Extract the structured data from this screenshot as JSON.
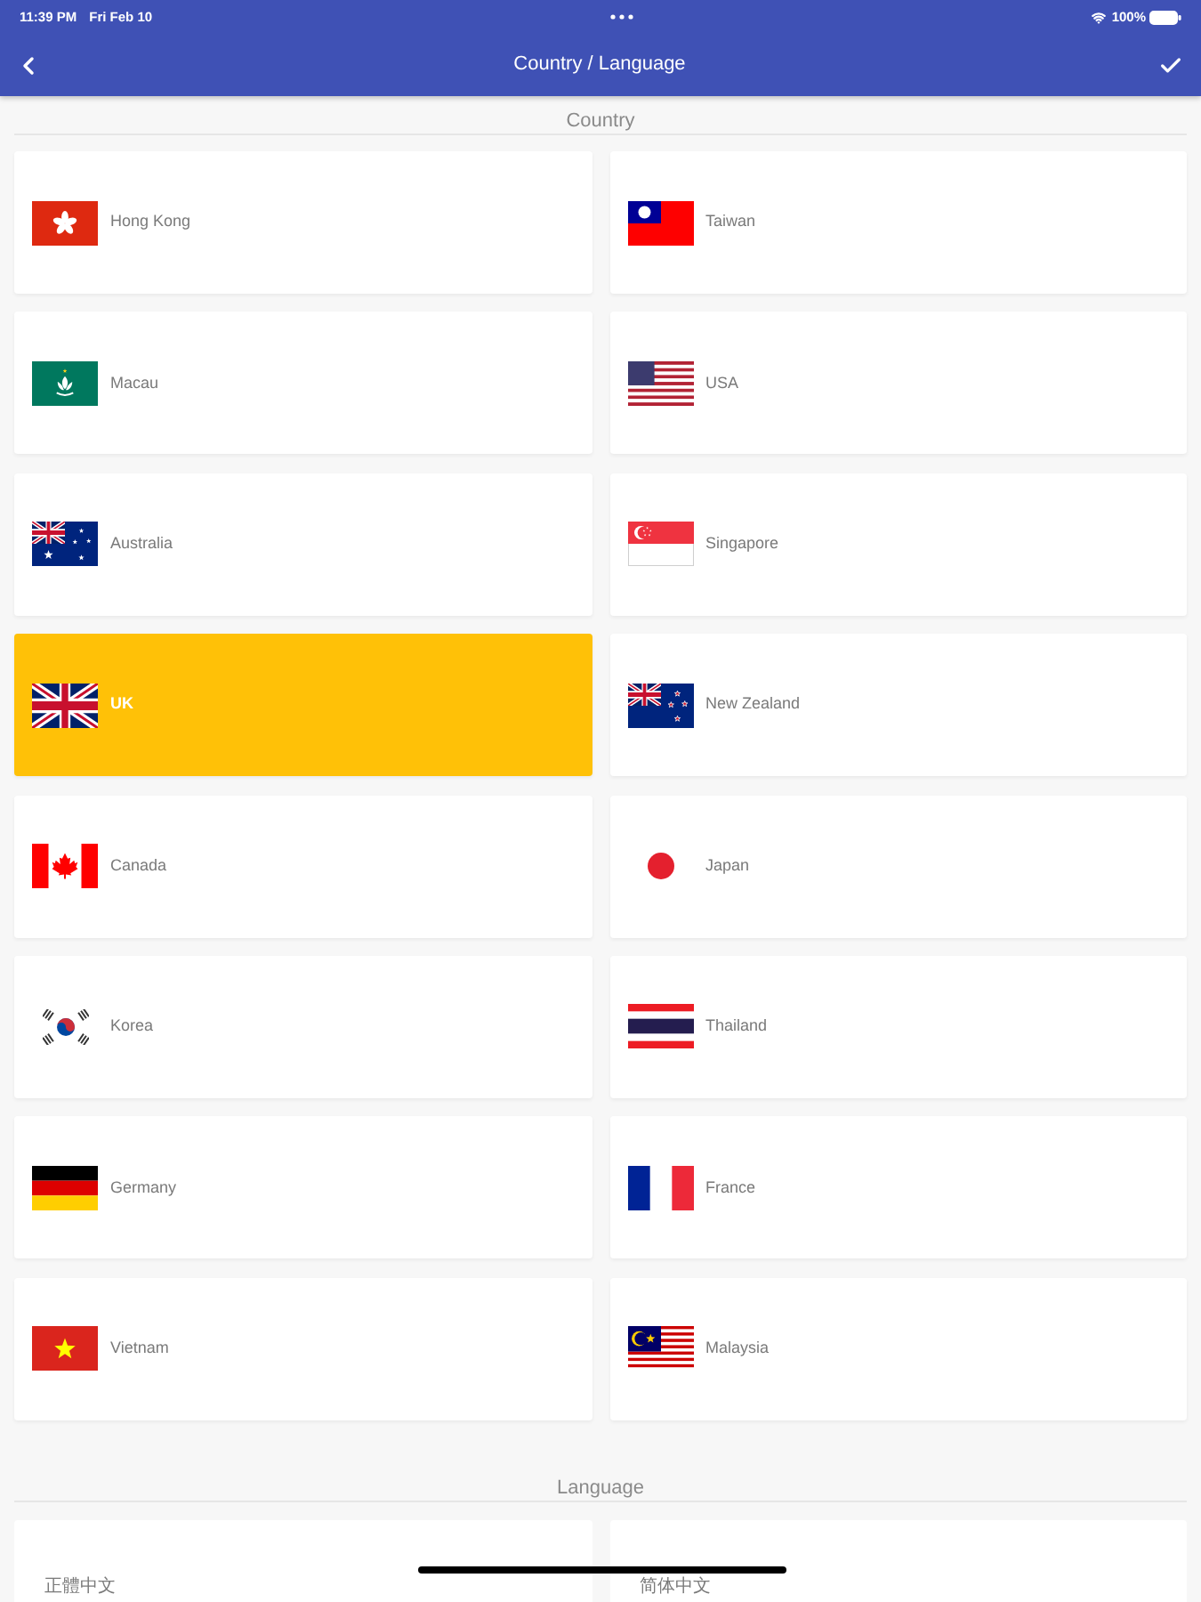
{
  "status_bar": {
    "time": "11:39 PM",
    "date": "Fri Feb 10",
    "battery": "100%"
  },
  "nav_bar": {
    "title": "Country / Language"
  },
  "country_section": {
    "heading": "Country",
    "items": [
      {
        "name": "Hong Kong",
        "kind": "hk",
        "selected": false
      },
      {
        "name": "Taiwan",
        "kind": "tw",
        "selected": false
      },
      {
        "name": "Macau",
        "kind": "mo",
        "selected": false
      },
      {
        "name": "USA",
        "kind": "us",
        "selected": false
      },
      {
        "name": "Australia",
        "kind": "au",
        "selected": false
      },
      {
        "name": "Singapore",
        "kind": "sg",
        "selected": false
      },
      {
        "name": "UK",
        "kind": "uk",
        "selected": true
      },
      {
        "name": "New Zealand",
        "kind": "nz",
        "selected": false
      },
      {
        "name": "Canada",
        "kind": "ca",
        "selected": false
      },
      {
        "name": "Japan",
        "kind": "jp",
        "selected": false
      },
      {
        "name": "Korea",
        "kind": "kr",
        "selected": false
      },
      {
        "name": "Thailand",
        "kind": "th",
        "selected": false
      },
      {
        "name": "Germany",
        "kind": "de",
        "selected": false
      },
      {
        "name": "France",
        "kind": "fr",
        "selected": false
      },
      {
        "name": "Vietnam",
        "kind": "vn",
        "selected": false
      },
      {
        "name": "Malaysia",
        "kind": "my",
        "selected": false
      }
    ]
  },
  "language_section": {
    "heading": "Language",
    "items": [
      {
        "name": "正體中文",
        "selected": false
      },
      {
        "name": "简体中文",
        "selected": false
      }
    ]
  }
}
